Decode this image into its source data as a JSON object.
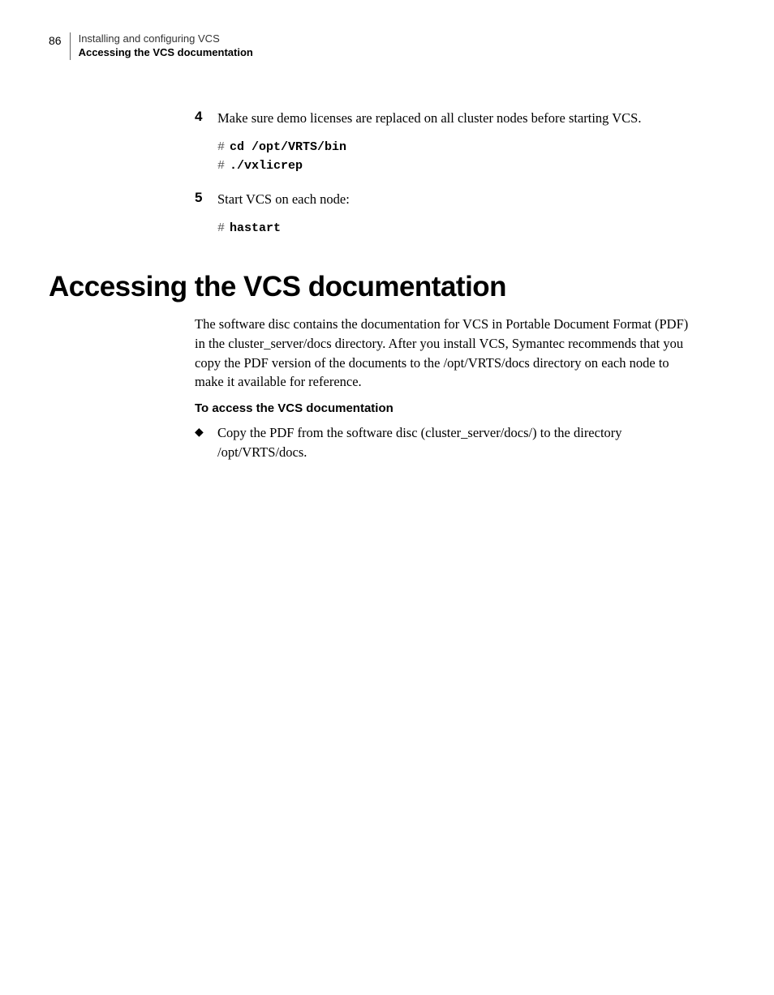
{
  "header": {
    "page_number": "86",
    "chapter_title": "Installing and configuring VCS",
    "section_title": "Accessing the VCS documentation"
  },
  "steps": [
    {
      "num": "4",
      "text": "Make sure demo licenses are replaced on all cluster nodes before starting VCS.",
      "code": [
        {
          "prompt": "#",
          "cmd": "cd /opt/VRTS/bin"
        },
        {
          "prompt": "#",
          "cmd": "./vxlicrep"
        }
      ]
    },
    {
      "num": "5",
      "text": "Start VCS on each node:",
      "code": [
        {
          "prompt": "#",
          "cmd": "hastart"
        }
      ]
    }
  ],
  "section_heading": "Accessing the VCS documentation",
  "section_paragraph": "The software disc contains the documentation for VCS in Portable Document Format (PDF) in the cluster_server/docs directory. After you install VCS, Symantec recommends that you copy the PDF version of the documents to the /opt/VRTS/docs directory on each node to make it available for reference.",
  "sub_heading": "To access the VCS documentation",
  "bullet": {
    "mark": "◆",
    "text": "Copy the PDF from the software disc (cluster_server/docs/) to the directory /opt/VRTS/docs."
  }
}
